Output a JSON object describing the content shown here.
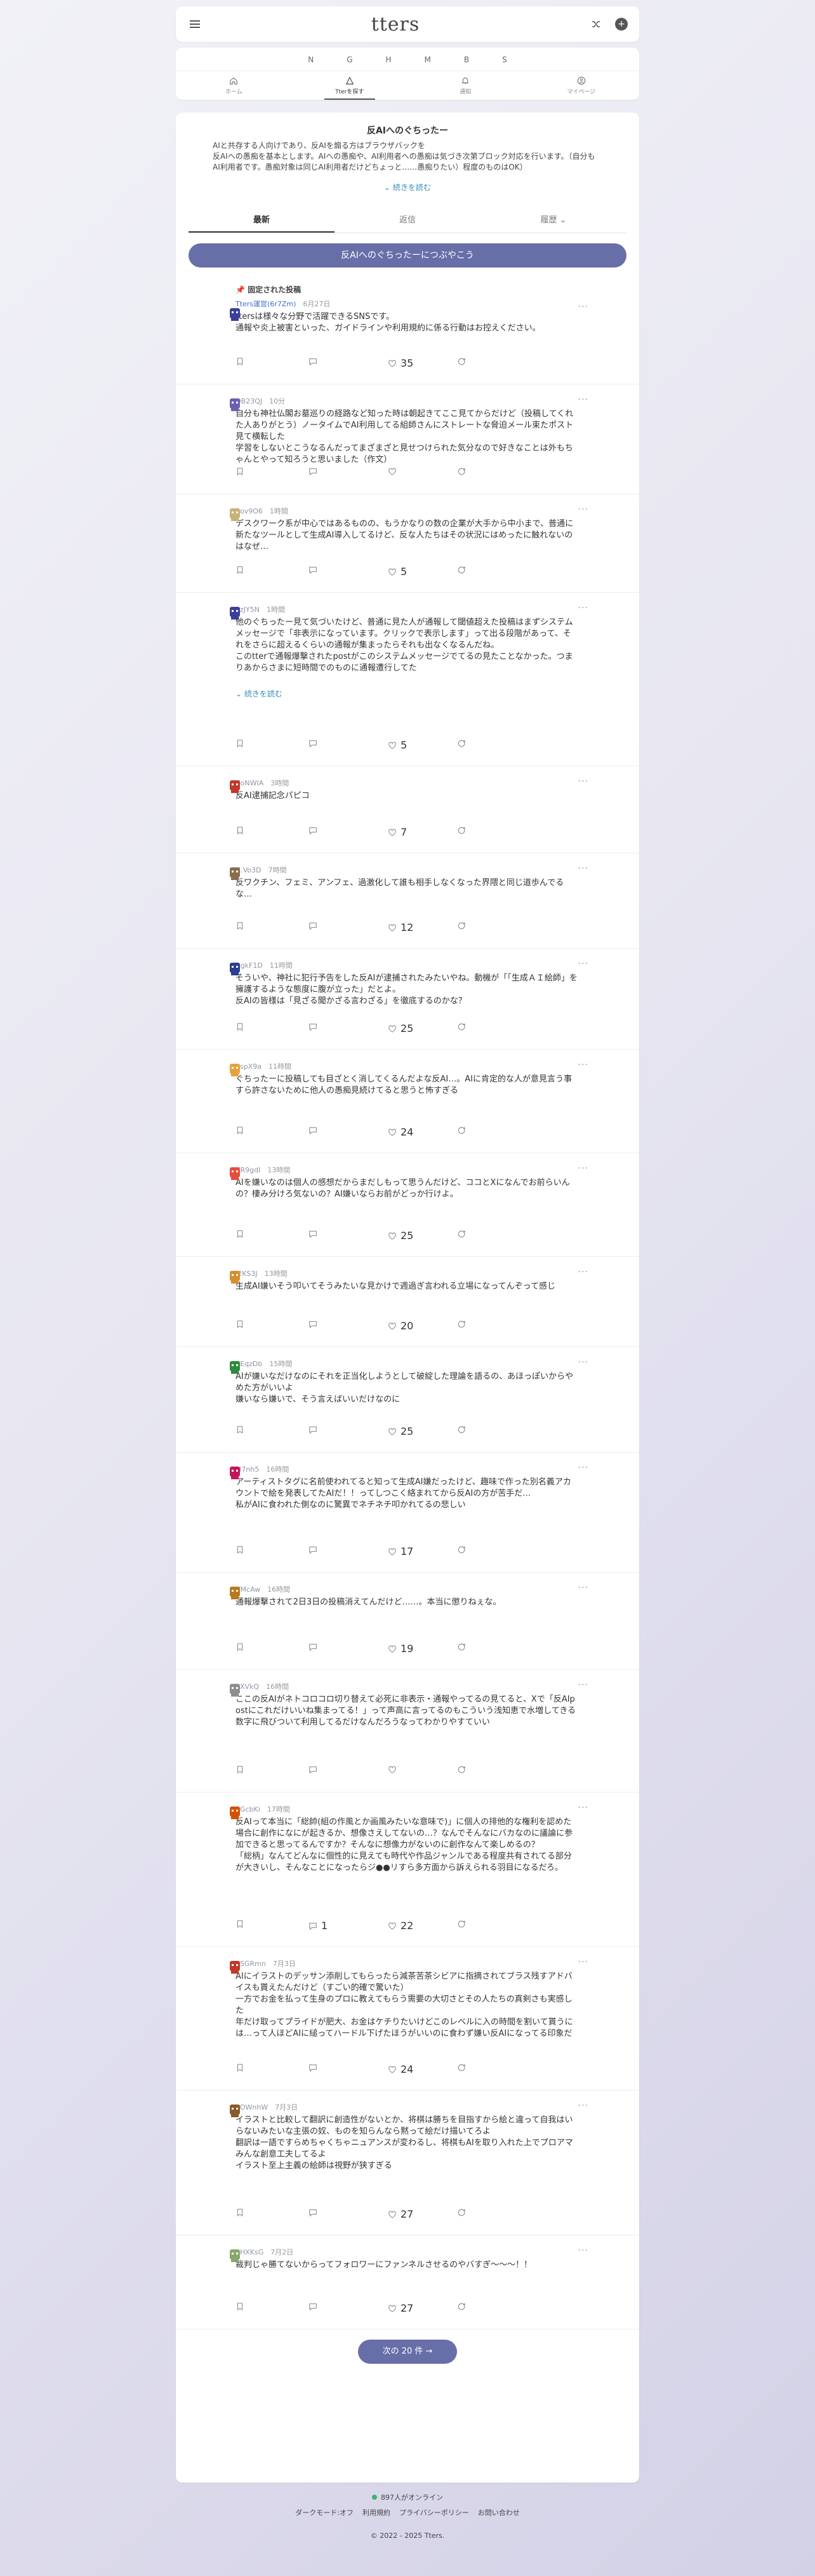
{
  "topbar": {
    "logo": "tters"
  },
  "nav": {
    "letters": [
      "N",
      "G",
      "H",
      "M",
      "B",
      "S"
    ],
    "tabs": [
      {
        "label": "ホーム"
      },
      {
        "label": "Tterを探す"
      },
      {
        "label": "通知"
      },
      {
        "label": "マイページ"
      }
    ]
  },
  "board": {
    "title": "反AIへのぐちったー",
    "description": "AIと共存する人向けであり、反AIを煽る方はブラウザバックを\n反AIへの愚痴を基本とします。AIへの愚痴や、AI利用者への愚痴は気づき次第ブロック対応を行います。（自分もAI利用者です。愚痴対象は同じAI利用者だけどちょっと……愚痴りたい）程度のものはOK）",
    "read_more": "続きを読む",
    "sort_tabs": [
      "最新",
      "返信",
      "履歴"
    ],
    "post_button": "反AIへのぐちったーにつぶやこう"
  },
  "posts": [
    {
      "pinned": "固定された投稿",
      "user": "Tters運営",
      "uid": "(6r7Zm)",
      "time": "6月27日",
      "body": "ttersは様々な分野で活躍できるSNSです。\n通報や炎上被害といった、ガイドラインや利用規約に係る行動はお控えください。",
      "replies": "",
      "likes": "35"
    },
    {
      "user": "",
      "uid": "OB23QJ",
      "time": "10分",
      "body": "自分も神社仏閣お墓巡りの経路など知った時は朝起きてここ見てからだけど（投稿してくれた人ありがとう）ノータイムでAI利用してる組師さんにストレートな脅迫メール束たポスト見て横転した\n学習をしないとこうなるんだってまざまざと見せつけられた気分なので好きなことは外もちゃんとやって知ろうと思いました（作文）",
      "replies": "",
      "likes": ""
    },
    {
      "user": "",
      "uid": "dov9O6",
      "time": "1時間",
      "body": "デスクワーク系が中心ではあるものの、もうかなりの数の企業が大手から中小まで、普通に新たなツールとして生成AI導入してるけど、反な人たちはその状況にはめったに触れないのはなぜ…",
      "replies": "",
      "likes": "5"
    },
    {
      "user": "",
      "uid": "9zJY5N",
      "time": "1時間",
      "body": "他のぐちったー見て気づいたけど、普通に見た人が通報して閾値超えた投稿はまずシステムメッセージで「非表示になっています。クリックで表示します」って出る段階があって、それをさらに超えるくらいの通報が集まったらそれも出なくなるんだね。\nこのtterで通報爆撃されたpostがこのシステムメッセージでてるの見たことなかった。つまりあからさまに短時間でのものに通報遭行してた",
      "cont": "続きを読む",
      "replies": "",
      "likes": "5"
    },
    {
      "user": "",
      "uid": "CoNWIA",
      "time": "3時間",
      "body": "反AI逮捕記念パピコ",
      "replies": "",
      "likes": "7"
    },
    {
      "user": "",
      "uid": "N.Vo3D",
      "time": "7時間",
      "body": "反ワクチン、フェミ、アンフェ、過激化して誰も相手しなくなった界隈と同じ道歩んでるな…",
      "replies": "",
      "likes": "12"
    },
    {
      "user": "",
      "uid": "RgkF1D",
      "time": "11時間",
      "body": "そういや、神社に犯行予告をした反AIが逮捕されたみたいやね。動機が「「生成ＡＩ絵師」を擁護するような態度に腹が立った」だとよ。\n反AIの皆様は「見ざる聞かざる言わざる」を徹底するのかな？",
      "replies": "",
      "likes": "25"
    },
    {
      "user": "",
      "uid": "hspX9a",
      "time": "11時間",
      "body": "ぐちったーに投稿しても目ざとく消してくるんだよな反AI…。AIに肯定的な人が意見言う事すら許さないために他人の愚痴見続けてると思うと怖すぎる",
      "replies": "",
      "likes": "24"
    },
    {
      "user": "",
      "uid": "XR9gdI",
      "time": "13時間",
      "body": "AIを嫌いなのは個人の感想だからまだしもって思うんだけど、ココとXになんでお前らいんの？棲み分けろ気ないの？AI嫌いならお前がどっか行けよ。",
      "replies": "",
      "likes": "25"
    },
    {
      "user": "",
      "uid": "J2KS3J",
      "time": "13時間",
      "body": "生成AI嫌いそう叩いてそうみたいな見かけで週過ぎ言われる立場になってんぞって感じ",
      "replies": "",
      "likes": "20"
    },
    {
      "user": "",
      "uid": "KEqzDb",
      "time": "15時間",
      "body": "AIが嫌いなだけなのにそれを正当化しようとして破綻した理論を語るの、あほっぽいからやめた方がいいよ\n嫌いなら嫌いで、そう言えばいいだけなのに",
      "replies": "",
      "likes": "25"
    },
    {
      "user": "",
      "uid": "LI7nh5",
      "time": "16時間",
      "body": "アーティストタグに名前使われてると知って生成AI嫌だったけど、趣味で作った別名義アカウントで絵を発表してたAIだ！！ってしつこく絡まれてから反AIの方が苦手だ…\n私がAIに食われた側なのに驚異でネチネチ叩かれてるの悲しい",
      "replies": "",
      "likes": "17"
    },
    {
      "user": "",
      "uid": "ZMcAw",
      "time": "16時間",
      "body": "通報爆撃されて2日3日の投稿消えてんだけど……。本当に懲りねぇな。",
      "replies": "",
      "likes": "19"
    },
    {
      "user": "",
      "uid": "bXVkQ",
      "time": "16時間",
      "body": "ここの反AIがネトコロコロ切り替えて必死に非表示・通報やってるの見てると、Xで「反AIpostにこれだけいいね集まってる！」って声高に言ってるのもこういう浅知恵で水増してきる数字に飛びついて利用してるだけなんだろうなってわかりやすていい",
      "replies": "",
      "likes": ""
    },
    {
      "user": "",
      "uid": "SGcbKi",
      "time": "17時間",
      "body": "反AIって本当に「総帥(組の作風とか画風みたいな意味で)」に個人の排他的な権利を認めた場合に創作になにが起きるか、想像さえしてないの…？なんでそんなにバカなのに議論に参加できると思ってるんですか？そんなに想像力がないのに創作なんて楽しめるの？\n「総柄」なんてどんなに個性的に見えても時代や作品ジャンルである程度共有されてる部分が大きいし、そんなことになったらジ●●リすら多方面から訴えられる羽目になるだろ。",
      "replies": "1",
      "likes": "22"
    },
    {
      "user": "",
      "uid": "SSGRmn",
      "time": "7月3日",
      "body": "AIにイラストのデッサン添削してもらったら減茶苦茶シビアに指摘されてブラス残すアドバイスも貰えたんだけど（すごい的確で驚いた）\n一方でお金を払って生身のプロに教えてもらう需要の大切さとその人たちの真剣さも実感した\n年だけ取ってプライドが肥大、お金はケチりたいけどこのレベルに入の時間を割いて貰うには…って人ほどAIに縋ってハードル下げたほうがいいのに食わず嫌い反AIになってる印象だ",
      "replies": "",
      "likes": "24"
    },
    {
      "user": "",
      "uid": "XOWnhW",
      "time": "7月3日",
      "body": "イラストと比較して翻訳に創造性がないとか、将棋は勝ちを目指すから絵と違って自我はいらないみたいな主張の奴、ものを知らんなら黙って絵だけ描いてろよ\n翻訳は一語ですらめちゃくちゃニュアンスが変わるし、将棋もAIを取り入れた上でプロアマみんな創意工夫してるよ\nイラスト至上主義の絵師は視野が狭すぎる",
      "replies": "",
      "likes": "27"
    },
    {
      "user": "",
      "uid": "8HXKsG",
      "time": "7月2日",
      "body": "裁判じゃ勝てないからってフォロワーにファンネルさせるのやバすぎ〜〜〜！！",
      "replies": "",
      "likes": "27"
    }
  ],
  "next_button": "次の 20 件",
  "footer": {
    "online": "897人がオンライン",
    "links": [
      "ダークモード:オフ",
      "利用規約",
      "プライバシーポリシー",
      "お問い合わせ"
    ],
    "copyright": "© 2022 - 2025 Tters."
  }
}
